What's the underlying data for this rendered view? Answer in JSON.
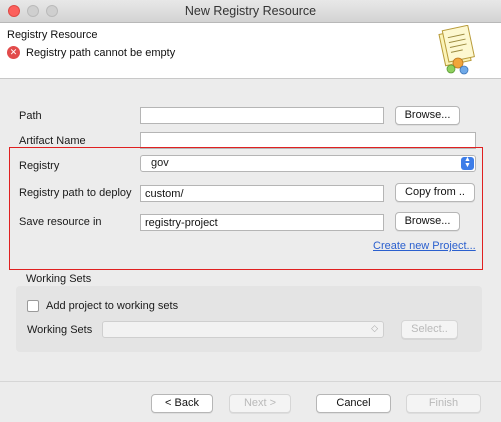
{
  "window": {
    "title": "New Registry Resource"
  },
  "header": {
    "title": "Registry Resource",
    "error_message": "Registry path cannot be empty",
    "error_icon": "error-x-icon"
  },
  "form": {
    "path": {
      "label": "Path",
      "value": "",
      "browse_label": "Browse..."
    },
    "artifact_name": {
      "label": "Artifact Name",
      "value": ""
    },
    "registry": {
      "label": "Registry",
      "selected": "gov"
    },
    "registry_path": {
      "label": "Registry path to deploy",
      "value": "custom/",
      "copy_label": "Copy from .."
    },
    "save_resource": {
      "label": "Save resource in",
      "value": "registry-project",
      "browse_label": "Browse..."
    },
    "create_project_link": "Create new Project..."
  },
  "working_sets": {
    "section_title": "Working Sets",
    "add_checkbox_label": "Add project to working sets",
    "add_checked": false,
    "label": "Working Sets",
    "selected": "",
    "select_button": "Select.."
  },
  "footer": {
    "back": "< Back",
    "next": "Next >",
    "cancel": "Cancel",
    "finish": "Finish"
  },
  "colors": {
    "highlight": "#e02020",
    "link": "#2a5fce",
    "error": "#e24b4b",
    "select_accent": "#3d7de8"
  }
}
